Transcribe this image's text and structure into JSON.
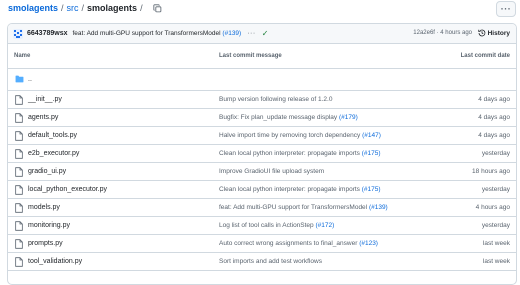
{
  "breadcrumb": {
    "repo": "smolagents",
    "folder": "src",
    "current": "smolagents",
    "separator": "/"
  },
  "more_button": {
    "label": "···",
    "icon": "kebab-horizontal-icon"
  },
  "latest_commit": {
    "author": "6643789wsx",
    "message": "feat: Add multi-GPU support for TransformersModel",
    "pr": "(#139)",
    "dots": "···",
    "status": "success",
    "status_icon": "check-icon",
    "hash_time": "12a2e6f · 4 hours ago",
    "history_label": "History",
    "history_icon": "history-icon"
  },
  "table": {
    "headers": {
      "name": "Name",
      "message": "Last commit message",
      "date": "Last commit date"
    },
    "parent_dir": "..",
    "rows": [
      {
        "name": "__init__.py",
        "message": "Bump version following release of 1.2.0",
        "pr": "",
        "date": "4 days ago"
      },
      {
        "name": "agents.py",
        "message": "Bugfix: Fix plan_update message display",
        "pr": "(#179)",
        "date": "4 days ago"
      },
      {
        "name": "default_tools.py",
        "message": "Halve import time by removing torch dependency",
        "pr": "(#147)",
        "date": "4 days ago"
      },
      {
        "name": "e2b_executor.py",
        "message": "Clean local python interpreter: propagate imports",
        "pr": "(#175)",
        "date": "yesterday"
      },
      {
        "name": "gradio_ui.py",
        "message": "Improve GradioUI file upload system",
        "pr": "",
        "date": "18 hours ago"
      },
      {
        "name": "local_python_executor.py",
        "message": "Clean local python interpreter: propagate imports",
        "pr": "(#175)",
        "date": "yesterday"
      },
      {
        "name": "models.py",
        "message": "feat: Add multi-GPU support for TransformersModel",
        "pr": "(#139)",
        "date": "4 hours ago"
      },
      {
        "name": "monitoring.py",
        "message": "Log list of tool calls in ActionStep",
        "pr": "(#172)",
        "date": "yesterday"
      },
      {
        "name": "prompts.py",
        "message": "Auto correct wrong assignments to final_answer",
        "pr": "(#123)",
        "date": "last week"
      },
      {
        "name": "tool_validation.py",
        "message": "Sort imports and add test workflows",
        "pr": "",
        "date": "last week"
      }
    ]
  },
  "colors": {
    "link": "#0969da",
    "text": "#1f2328",
    "muted": "#59636e",
    "border": "#d1d9e0",
    "header_bg": "#f6f8fa",
    "folder": "#54aeff",
    "success": "#1a7f37"
  }
}
